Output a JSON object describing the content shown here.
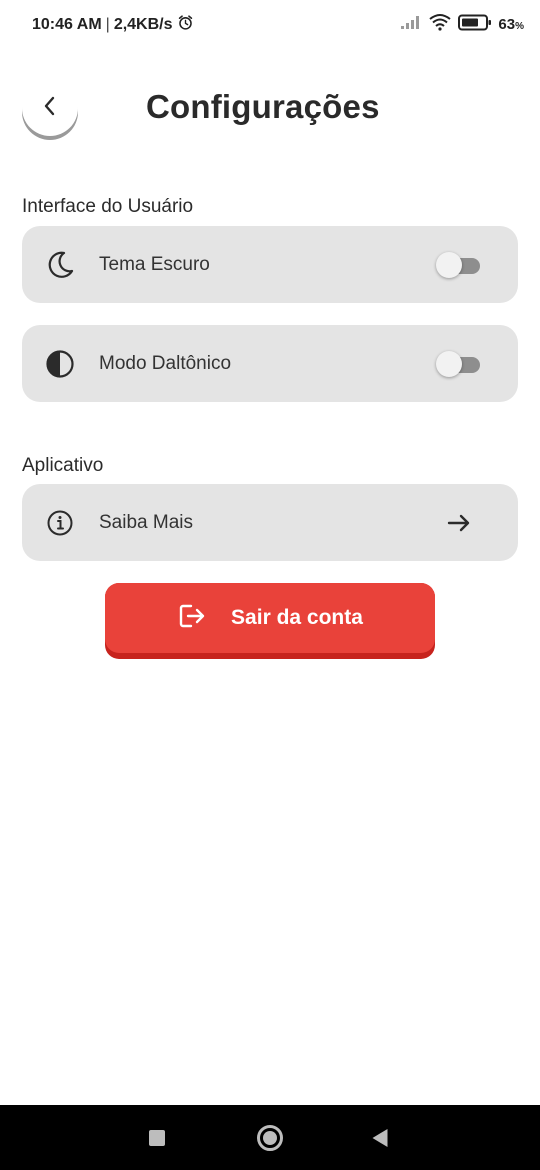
{
  "status_bar": {
    "time": "10:46 AM",
    "separator": "|",
    "speed": "2,4KB/s",
    "battery": "63",
    "battery_unit": "%"
  },
  "header": {
    "title": "Configurações"
  },
  "sections": {
    "interface": {
      "label": "Interface do Usuário",
      "items": [
        {
          "label": "Tema Escuro",
          "icon": "moon-icon",
          "toggle_on": false
        },
        {
          "label": "Modo Daltônico",
          "icon": "contrast-icon",
          "toggle_on": false
        }
      ]
    },
    "app": {
      "label": "Aplicativo",
      "items": [
        {
          "label": "Saiba Mais",
          "icon": "info-icon"
        }
      ]
    }
  },
  "logout": {
    "label": "Sair da conta"
  },
  "colors": {
    "card_bg": "#e4e4e4",
    "logout_bg": "#e9423a",
    "logout_shadow": "#c7231d",
    "toggle_track": "#8e8e8e"
  }
}
